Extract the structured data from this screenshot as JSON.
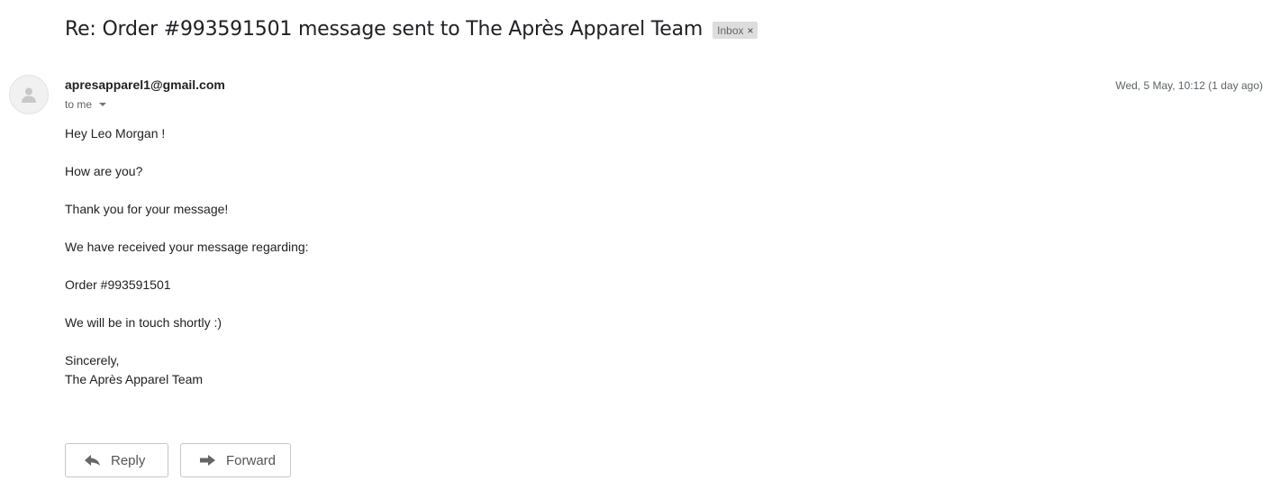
{
  "email": {
    "subject": "Re: Order #993591501 message sent to The Après Apparel Team",
    "label": "Inbox",
    "label_remove": "×",
    "sender": "apresapparel1@gmail.com",
    "recipient_line": "to me",
    "date": "Wed, 5 May, 10:12 (1 day ago)",
    "body_lines": [
      "Hey Leo Morgan !",
      "",
      "How are you?",
      "",
      "Thank you for your message!",
      "",
      "We have received your message regarding:",
      "",
      "Order #993591501",
      "",
      "We will be in touch shortly :)",
      "",
      "Sincerely,",
      "The Après Apparel Team"
    ]
  },
  "actions": {
    "reply_label": "Reply",
    "forward_label": "Forward"
  },
  "icons": {
    "avatar": "person-icon",
    "reply": "reply-arrow-icon",
    "forward": "forward-arrow-icon",
    "recipient_toggle": "caret-down-icon"
  },
  "colors": {
    "label_chip_bg": "#dddddd",
    "muted_text": "#5f6368",
    "button_border": "#c6c6c6"
  }
}
